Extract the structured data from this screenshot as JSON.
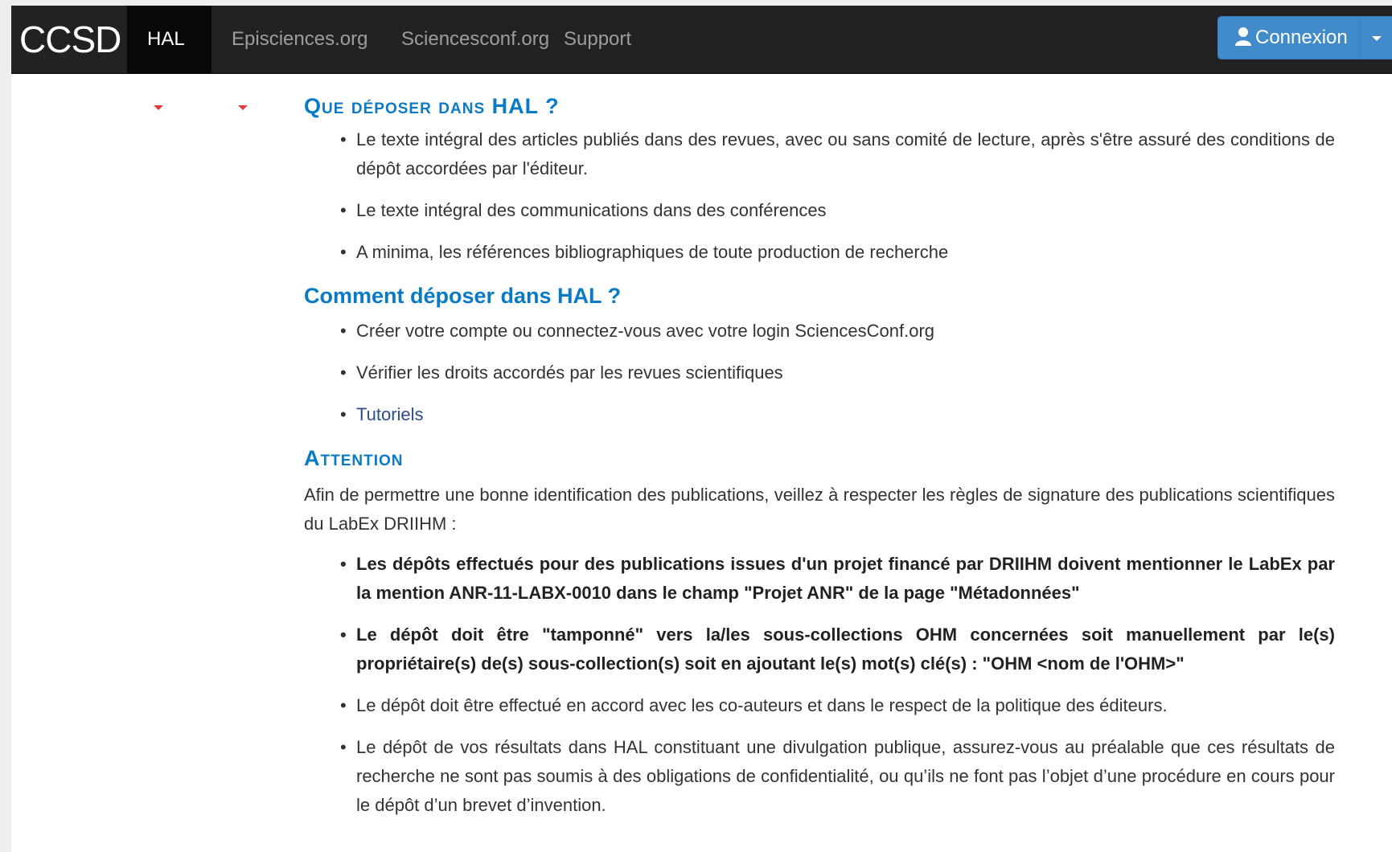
{
  "navbar": {
    "brand": "CCSD",
    "items": [
      {
        "label": "HAL",
        "dropdown": true,
        "active": true
      },
      {
        "label": "Episciences.org",
        "dropdown": true,
        "active": false
      },
      {
        "label": "Sciencesconf.org",
        "dropdown": false,
        "active": false
      },
      {
        "label": "Support",
        "dropdown": false,
        "active": false
      }
    ],
    "login_label": "Connexion",
    "login_icon": "user-icon"
  },
  "colors": {
    "navbar_bg": "#222222",
    "heading": "#0b7ac4",
    "button": "#428bca",
    "accent_red": "#e2383f"
  },
  "sections": [
    {
      "title": "Que déposer dans HAL ?",
      "items": [
        "Le texte intégral des articles publiés dans des revues, avec ou sans comité de lecture, après s'être assuré des conditions de dépôt accordées par l'éditeur.",
        "Le texte intégral des communications dans des conférences",
        "A minima, les références bibliographiques de toute production de recherche"
      ]
    },
    {
      "title": "Comment déposer dans HAL ?",
      "items": [
        "Créer votre compte ou connectez-vous avec votre login SciencesConf.org",
        "Vérifier les droits accordés par les revues scientifiques",
        "Tutoriels"
      ]
    },
    {
      "title": "Attention",
      "intro": "Afin de permettre une bonne identification des publications, veillez à respecter les règles de signature des publications scientifiques du LabEx DRIIHM :",
      "items": [
        "Les dépôts effectués pour des publications issues d'un projet financé par DRIIHM doivent mentionner le LabEx par la mention ANR-11-LABX-0010 dans le champ \"Projet ANR\" de la page \"Métadonnées\"",
        "Le dépôt doit être \"tamponné\" vers la/les sous-collections OHM concernées soit manuellement par le(s) propriétaire(s) de(s) sous-collection(s) soit en ajoutant le(s) mot(s) clé(s) : \"OHM <nom de l'OHM>\"",
        "Le dépôt doit être effectué en accord avec les co-auteurs et dans le respect de la politique des éditeurs.",
        "Le dépôt de vos résultats dans HAL constituant une divulgation publique, assurez-vous au préalable que ces résultats de recherche ne sont pas soumis à des obligations de confidentialité, ou qu’ils ne font pas l’objet d’une procédure en cours pour le dépôt d’un brevet d’invention."
      ]
    }
  ]
}
